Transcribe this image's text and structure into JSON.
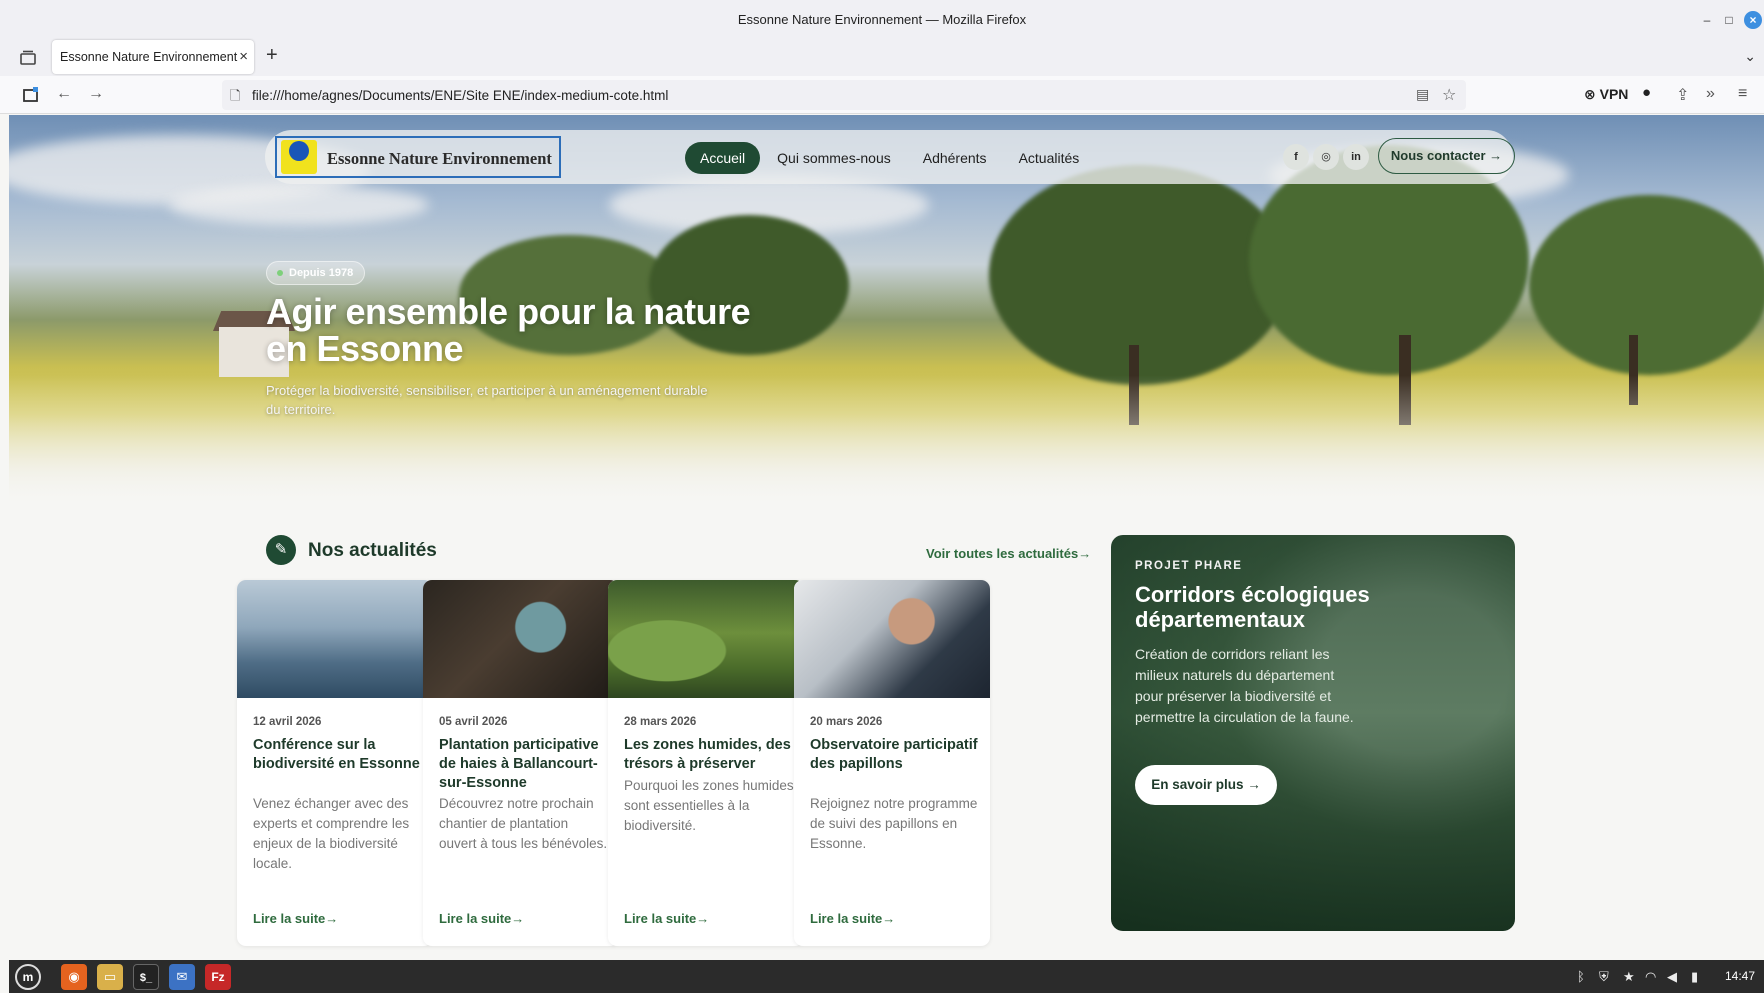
{
  "window": {
    "title": "Essonne Nature Environnement — Mozilla Firefox"
  },
  "browser": {
    "tab_title": "Essonne Nature Environnement",
    "url": "file:///home/agnes/Documents/ENE/Site ENE/index-medium-cote.html",
    "vpn_label": "VPN"
  },
  "site": {
    "logo_text": "Essonne Nature Environnement",
    "nav": [
      "Accueil",
      "Qui sommes-nous",
      "Adhérents",
      "Actualités"
    ],
    "social": [
      "f",
      "◎",
      "in"
    ],
    "contact_label": "Nous contacter →"
  },
  "hero": {
    "badge": "Depuis 1978",
    "title": "Agir ensemble pour la nature en Essonne",
    "subtitle": "Protéger la biodiversité, sensibiliser, et participer à un aménagement durable du territoire."
  },
  "news": {
    "heading": "Nos actualités",
    "see_all": "Voir toutes les actualités→",
    "read_more": "Lire la suite→",
    "cards": [
      {
        "date": "12 avril 2026",
        "title": "Conférence sur la biodiversité en Essonne",
        "text": "Venez échanger avec des experts et comprendre les enjeux de la biodiversité locale."
      },
      {
        "date": "05 avril 2026",
        "title": "Plantation participative de haies à Ballancourt-sur-Essonne",
        "text": "Découvrez notre prochain chantier de plantation ouvert à tous les bénévoles."
      },
      {
        "date": "28 mars 2026",
        "title": "Les zones humides, des trésors à préserver",
        "text": "Pourquoi les zones humides sont essentielles à la biodiversité."
      },
      {
        "date": "20 mars 2026",
        "title": "Observatoire participatif des papillons",
        "text": "Rejoignez notre programme de suivi des papillons en Essonne."
      }
    ]
  },
  "feature": {
    "eyebrow": "PROJET PHARE",
    "title": "Corridors écologiques départementaux",
    "text": "Création de corridors reliant les milieux naturels du département pour préserver la biodiversité et permettre la circulation de la faune.",
    "button": "En savoir plus →"
  },
  "taskbar": {
    "clock": "14:47"
  }
}
